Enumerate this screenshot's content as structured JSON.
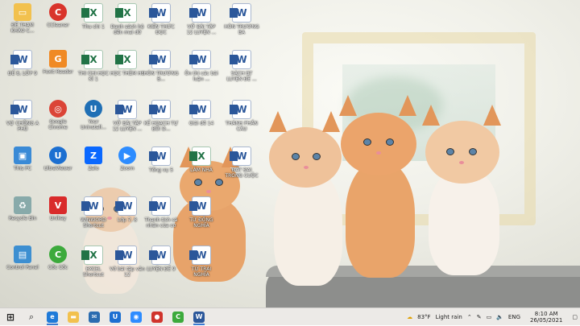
{
  "desktop": {
    "icons": [
      {
        "label": "ĐỀ THAM KHẢO C...",
        "icon": "folder-icon",
        "color": "#f2c14e"
      },
      {
        "label": "CCleaner",
        "icon": "ccleaner-icon",
        "color": "#d9342b"
      },
      {
        "label": "Thu chi 1",
        "icon": "excel-icon",
        "color": "#217346"
      },
      {
        "label": "Danh sách hộ đến mai dữ",
        "icon": "excel-icon",
        "color": "#217346"
      },
      {
        "label": "KIẾN THỨC ĐỌC",
        "icon": "word-icon",
        "color": "#2b579a"
      },
      {
        "label": "VỞ BÀI TẬP 12 LUYỆN ...",
        "icon": "word-icon",
        "color": "#2b579a"
      },
      {
        "label": "HÒN TRƯƠNG BA",
        "icon": "word-icon",
        "color": "#2b579a"
      },
      {
        "label": "ĐỀ 8, LỚP 9",
        "icon": "word-icon",
        "color": "#2b579a"
      },
      {
        "label": "Foxit Reader",
        "icon": "foxit-icon",
        "color": "#f08a24"
      },
      {
        "label": "THI CHI HỌC KÌ 1",
        "icon": "excel-icon",
        "color": "#217346"
      },
      {
        "label": "HỌC THÊM HS",
        "icon": "excel-icon",
        "color": "#217346"
      },
      {
        "label": "HÒN TRƯƠNG B...",
        "icon": "word-icon",
        "color": "#2b579a"
      },
      {
        "label": "Ôn thi các bài luận ...",
        "icon": "word-icon",
        "color": "#2b579a"
      },
      {
        "label": "SÁCH BT LUYỆN ĐỀ ...",
        "icon": "word-icon",
        "color": "#2b579a"
      },
      {
        "label": "VỢ CHỒNG A PHỦ",
        "icon": "word-icon",
        "color": "#2b579a"
      },
      {
        "label": "Google Chrome",
        "icon": "chrome-icon",
        "color": "#db4437"
      },
      {
        "label": "Your Uninstall...",
        "icon": "uninstall-icon",
        "color": "#1f6fb5"
      },
      {
        "label": "VỞ BÀI TẬP 12 LUYỆN ...",
        "icon": "word-icon",
        "color": "#2b579a"
      },
      {
        "label": "KẾ HOẠCH TỰ BỒI D...",
        "icon": "word-icon",
        "color": "#2b579a"
      },
      {
        "label": "Giải đề 14",
        "icon": "word-icon",
        "color": "#2b579a"
      },
      {
        "label": "THÀNH PHẦN CÂU",
        "icon": "word-icon",
        "color": "#2b579a"
      },
      {
        "label": "This PC",
        "icon": "pc-icon",
        "color": "#3a8ad6"
      },
      {
        "label": "UltraViewer",
        "icon": "ultraviewer-icon",
        "color": "#1c6fd1"
      },
      {
        "label": "Zalo",
        "icon": "zalo-icon",
        "color": "#0a68ff"
      },
      {
        "label": "Zoom",
        "icon": "zoom-icon",
        "color": "#2d8cff"
      },
      {
        "label": "Tổng vụ 5",
        "icon": "word-icon",
        "color": "#2b579a"
      },
      {
        "label": "LÀM NHÁ",
        "icon": "excel-icon",
        "color": "#217346"
      },
      {
        "label": "ĐẤT ĐAI TRONG CUỘC",
        "icon": "word-icon",
        "color": "#2b579a"
      },
      {
        "label": "Recycle Bin",
        "icon": "recycle-bin-icon",
        "color": "#8aa"
      },
      {
        "label": "Unikey",
        "icon": "unikey-icon",
        "color": "#d92b2b"
      },
      {
        "label": "WINWORD Shortcut",
        "icon": "word-icon",
        "color": "#2b579a"
      },
      {
        "label": "Lớp 7, 8",
        "icon": "word-icon",
        "color": "#2b579a"
      },
      {
        "label": "Thanh tích cá nhân của cơ",
        "icon": "word-icon",
        "color": "#2b579a"
      },
      {
        "label": "TỪ ĐỒNG NGHĨA",
        "icon": "word-icon",
        "color": "#2b579a"
      },
      {
        "label": "Control Panel",
        "icon": "control-panel-icon",
        "color": "#3d8fd1"
      },
      {
        "label": "Cốc Cốc",
        "icon": "coccoc-icon",
        "color": "#3caa3c"
      },
      {
        "label": "EXCEL Shortcut",
        "icon": "excel-icon",
        "color": "#217346"
      },
      {
        "label": "Vở bài tập văn 12",
        "icon": "word-icon",
        "color": "#2b579a"
      },
      {
        "label": "LUYỆN ĐỀ 9",
        "icon": "word-icon",
        "color": "#2b579a"
      },
      {
        "label": "TỪ TRÁI NGHĨA",
        "icon": "word-icon",
        "color": "#2b579a"
      }
    ]
  },
  "taskbar": {
    "apps": [
      {
        "name": "start-button",
        "glyph": "⊞",
        "color": "#222"
      },
      {
        "name": "taskbar-edge",
        "glyph": "e",
        "color": "#1f7ad8"
      },
      {
        "name": "taskbar-file-explorer",
        "glyph": "▬",
        "color": "#f2c14e"
      },
      {
        "name": "taskbar-mail",
        "glyph": "✉",
        "color": "#2b6cb0"
      },
      {
        "name": "taskbar-ultraviewer",
        "glyph": "U",
        "color": "#1c6fd1"
      },
      {
        "name": "taskbar-zoom",
        "glyph": "◉",
        "color": "#2d8cff"
      },
      {
        "name": "taskbar-recorder",
        "glyph": "●",
        "color": "#d0342c"
      },
      {
        "name": "taskbar-coccoc",
        "glyph": "C",
        "color": "#3caa3c"
      },
      {
        "name": "taskbar-word",
        "glyph": "W",
        "color": "#2b579a"
      }
    ],
    "weather": {
      "temp": "83°F",
      "condition": "Light rain"
    },
    "language": "ENG",
    "time": "8:10 AM",
    "date": "26/05/2021"
  }
}
